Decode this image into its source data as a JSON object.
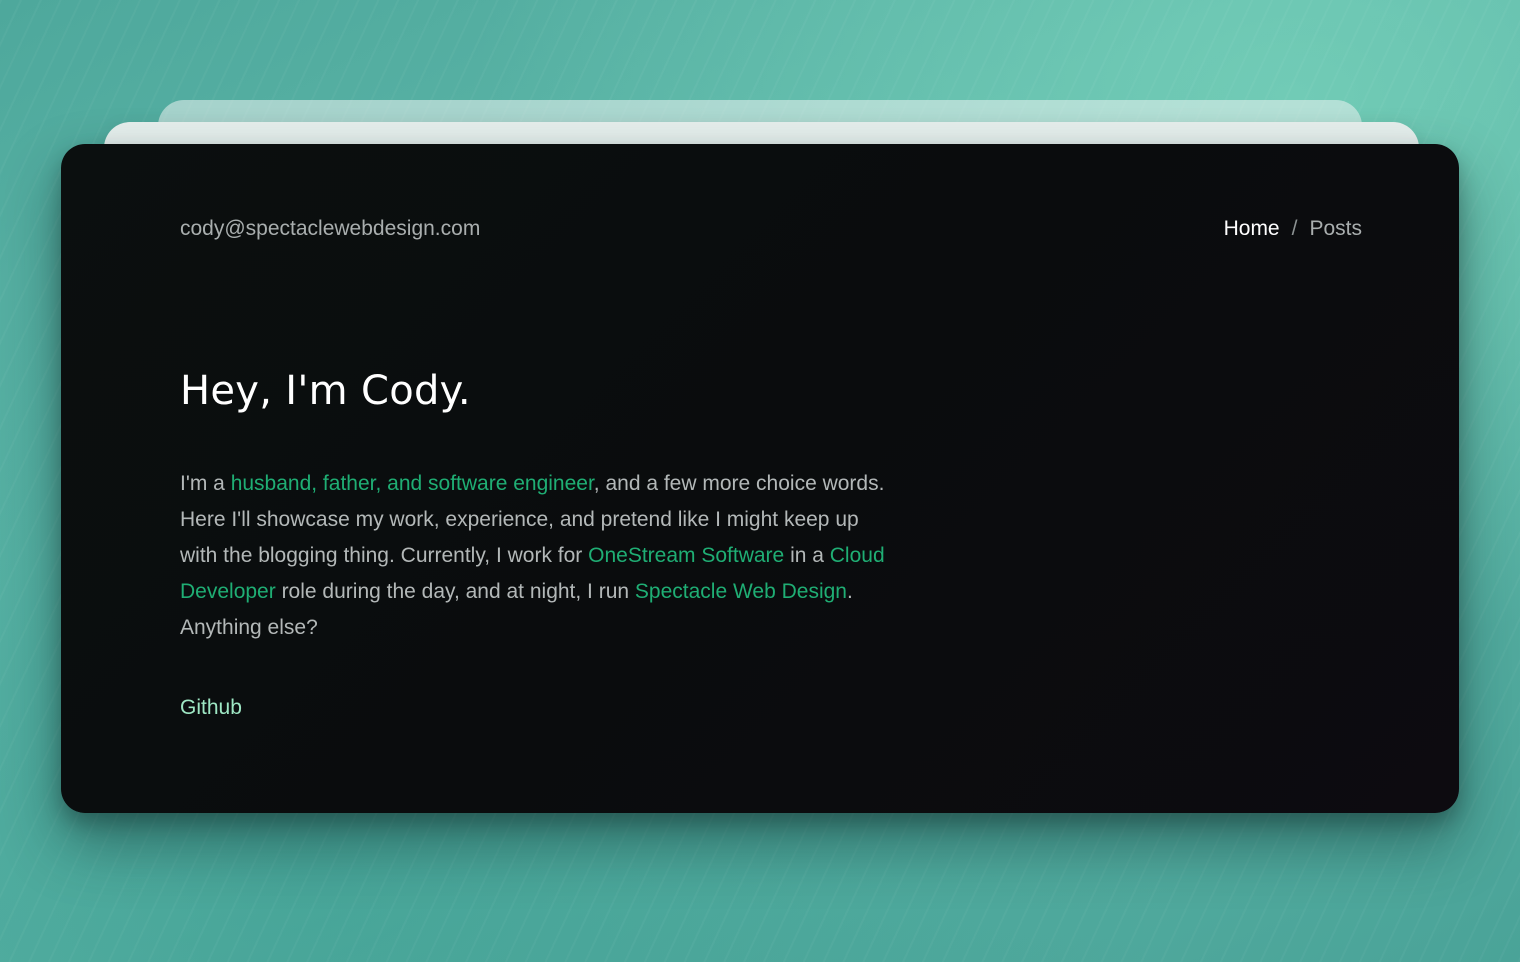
{
  "header": {
    "email": "cody@spectaclewebdesign.com",
    "nav": {
      "home": "Home",
      "separator": "/",
      "posts": "Posts"
    }
  },
  "hero": {
    "heading": "Hey, I'm Cody.",
    "bio": {
      "t1": "I'm a ",
      "link_roles": "husband, father, and software engineer",
      "t2": ", and a few more choice words. Here I'll showcase my work, experience, and pretend like I might keep up with the blogging thing. Currently, I work for ",
      "link_company": "OneStream Software",
      "t3": " in a ",
      "link_role": "Cloud Developer",
      "t4": " role during the day, and at night, I run ",
      "link_business": "Spectacle Web Design",
      "t5": ". Anything else?"
    },
    "github_label": "Github"
  },
  "colors": {
    "background": "#56b0a3",
    "card": "#0b0e0f",
    "link_green": "#1fae74",
    "github_mint": "#9ee7c4",
    "body_text": "#b3b8b8"
  }
}
